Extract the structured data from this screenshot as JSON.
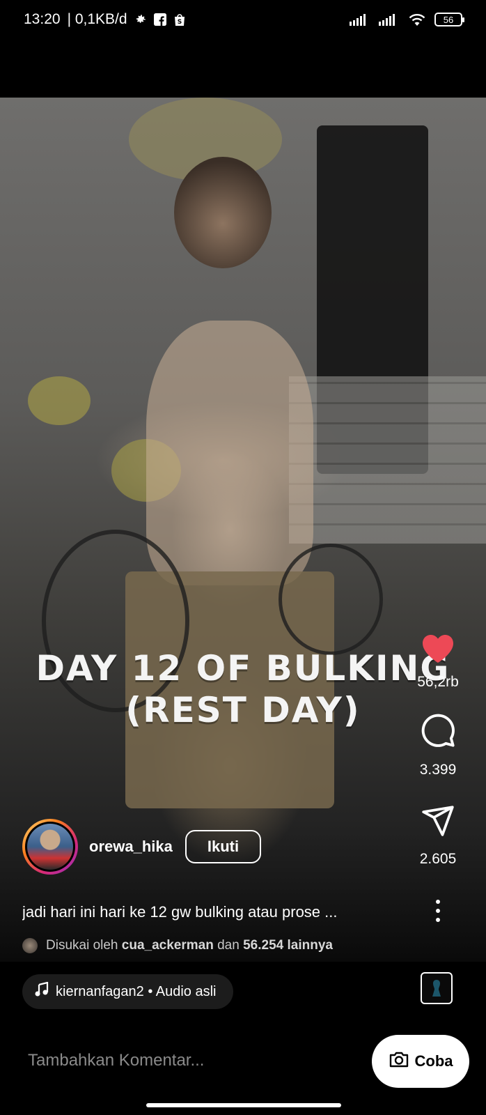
{
  "status": {
    "time": "13:20",
    "speed": "| 0,1KB/d",
    "battery": "56"
  },
  "video": {
    "overlay_line1": "DAY 12 OF BULKING",
    "overlay_line2": "(REST DAY)"
  },
  "actions": {
    "likes": "56,2rb",
    "comments": "3.399",
    "shares": "2.605",
    "like_color": "#ed4956"
  },
  "author": {
    "username": "orewa_hika",
    "follow_label": "Ikuti"
  },
  "caption": "jadi hari ini hari ke 12 gw bulking atau prose ...",
  "liked_by": {
    "prefix": "Disukai oleh",
    "user": "cua_ackerman",
    "middle": "dan",
    "others": "56.254 lainnya"
  },
  "audio": {
    "label": "kiernanfagan2 • Audio asli"
  },
  "comment": {
    "placeholder": "Tambahkan Komentar...",
    "camera_label": "Coba"
  }
}
